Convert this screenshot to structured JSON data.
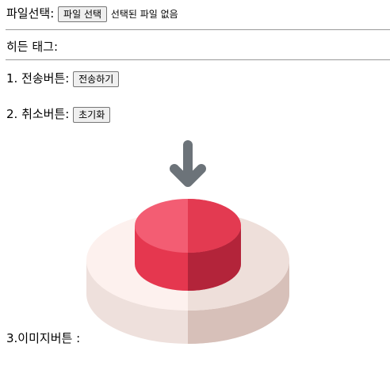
{
  "file_select": {
    "label": "파일선택:",
    "button_label": "파일 선택",
    "status": "선택된 파일 없음"
  },
  "hidden_tag": {
    "label": "히든 태그:"
  },
  "submit_row": {
    "label": "1. 전송버튼:",
    "button_label": "전송하기"
  },
  "reset_row": {
    "label": "2. 취소버튼:",
    "button_label": "초기화"
  },
  "image_row": {
    "label": "3.이미지버튼 :",
    "image_icon": "push-button-with-down-arrow-icon"
  },
  "colors": {
    "button_red_light": "#f25a70",
    "button_red_dark": "#c4283c",
    "base_light": "#fdf1ee",
    "base_shadow": "#e2cdc6",
    "arrow": "#6c7379"
  }
}
